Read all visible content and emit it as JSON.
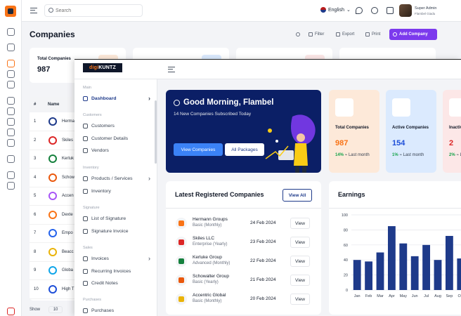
{
  "topbar": {
    "search_placeholder": "Search",
    "language": "English",
    "user_name": "Super Admin",
    "user_role": "Flambel Giadu"
  },
  "page": {
    "title": "Companies",
    "filter": "Filter",
    "export": "Export",
    "print": "Print",
    "add": "Add Company"
  },
  "stats": [
    {
      "label": "Total Companies",
      "value": "987"
    }
  ],
  "table": {
    "col_num": "#",
    "col_name": "Name",
    "rows": [
      {
        "n": "1",
        "name": "Herma",
        "color": "#1e3a8a"
      },
      {
        "n": "2",
        "name": "Skiles",
        "color": "#dc2626"
      },
      {
        "n": "3",
        "name": "Kerluk",
        "color": "#15803d"
      },
      {
        "n": "4",
        "name": "Schow",
        "color": "#ea580c"
      },
      {
        "n": "5",
        "name": "Accen",
        "color": "#a855f7"
      },
      {
        "n": "6",
        "name": "Dexte",
        "color": "#f97316"
      },
      {
        "n": "7",
        "name": "Empo",
        "color": "#2563eb"
      },
      {
        "n": "8",
        "name": "Beacc",
        "color": "#eab308"
      },
      {
        "n": "9",
        "name": "Globa",
        "color": "#0ea5e9"
      },
      {
        "n": "10",
        "name": "High T",
        "color": "#1d4ed8"
      }
    ],
    "show_label": "Show",
    "show_value": "10"
  },
  "overlay": {
    "brand_a": "digi",
    "brand_b": "KUNTZ",
    "sidebar": {
      "main": "Main",
      "dashboard": "Dashboard",
      "customers_sec": "Customers",
      "customers": "Customers",
      "customer_details": "Customer Details",
      "vendors": "Vendors",
      "inventory_sec": "Inventory",
      "products": "Products / Services",
      "inventory": "Inventory",
      "signature_sec": "Signature",
      "list_signature": "List of Signature",
      "signature_invoice": "Signature Invoice",
      "sales_sec": "Sales",
      "invoices": "Invoices",
      "recurring": "Recurring Invoices",
      "credit": "Credit Notes",
      "purchases_sec": "Purchases",
      "purchases": "Purchases"
    },
    "hero": {
      "greeting": "Good Morning, Flambel",
      "subtitle": "14 New Companies Subscribed Today",
      "btn_view": "View Companies",
      "btn_packages": "All Packages"
    },
    "cards": [
      {
        "label": "Total Companies",
        "value": "987",
        "pct": "14%",
        "tail": "Last month",
        "bg": "#fde9d9",
        "vcolor": "#f97316"
      },
      {
        "label": "Active Companies",
        "value": "154",
        "pct": "1%",
        "tail": "Last month",
        "bg": "#dbeafe",
        "vcolor": "#1d4ed8"
      },
      {
        "label": "Inactive Companies",
        "value": "2",
        "pct": "2%",
        "tail": "Last month",
        "bg": "#fce7e7",
        "vcolor": "#dc2626"
      }
    ],
    "latest": {
      "title": "Latest Registered Companies",
      "view_all": "View All",
      "view": "View",
      "rows": [
        {
          "name": "Hermann Groups",
          "plan": "Basic (Monthly)",
          "date": "24 Feb 2024",
          "color": "#f97316"
        },
        {
          "name": "Skiles LLC",
          "plan": "Enterprise (Yearly)",
          "date": "23 Feb 2024",
          "color": "#dc2626"
        },
        {
          "name": "Kerluke Group",
          "plan": "Advanced (Monthly)",
          "date": "22 Feb 2024",
          "color": "#15803d"
        },
        {
          "name": "Schowalter Group",
          "plan": "Basic (Yearly)",
          "date": "21 Feb 2024",
          "color": "#ea580c"
        },
        {
          "name": "Accentric Global",
          "plan": "Basic (Monthly)",
          "date": "20 Feb 2024",
          "color": "#eab308"
        }
      ]
    },
    "earnings": {
      "title": "Earnings"
    }
  },
  "chart_data": {
    "type": "bar",
    "categories": [
      "Jan",
      "Feb",
      "Mar",
      "Apr",
      "May",
      "Jun",
      "Jul",
      "Aug",
      "Sep",
      "Oct"
    ],
    "values": [
      40,
      38,
      50,
      85,
      62,
      45,
      60,
      40,
      72,
      42
    ],
    "title": "Earnings",
    "ylim": [
      0,
      100
    ],
    "yticks": [
      0,
      20,
      40,
      60,
      80,
      100
    ],
    "bar_color": "#1e3a8a"
  }
}
